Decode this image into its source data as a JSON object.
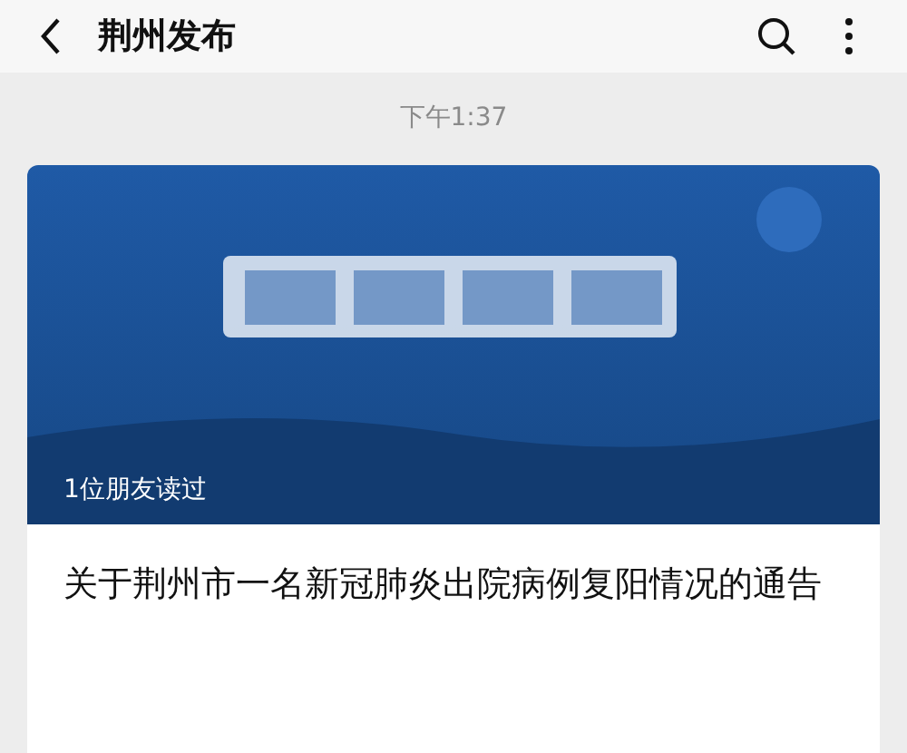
{
  "header": {
    "title": "荆州发布"
  },
  "timestamp": "下午1:37",
  "article": {
    "read_by": "1位朋友读过",
    "title": "关于荆州市一名新冠肺炎出院病例复阳情况的通告"
  }
}
